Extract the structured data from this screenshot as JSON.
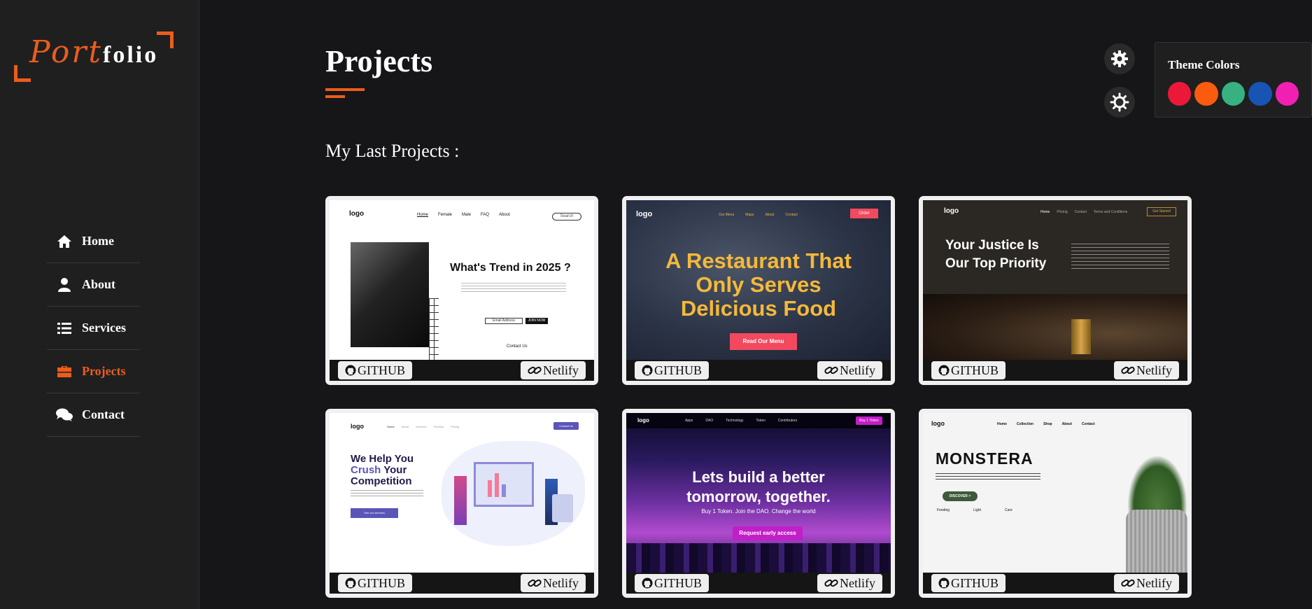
{
  "logo": {
    "part1": "Port",
    "part2": "folio"
  },
  "nav": [
    {
      "label": "Home",
      "icon": "home-icon"
    },
    {
      "label": "About",
      "icon": "user-icon"
    },
    {
      "label": "Services",
      "icon": "list-icon"
    },
    {
      "label": "Projects",
      "icon": "briefcase-icon",
      "active": true
    },
    {
      "label": "Contact",
      "icon": "comments-icon"
    }
  ],
  "page": {
    "title": "Projects",
    "subtitle": "My Last Projects :"
  },
  "theme": {
    "title": "Theme Colors",
    "colors": [
      "#ec1839",
      "#fa5b0f",
      "#37b182",
      "#1854b4",
      "#f021b2"
    ],
    "accent": "#ec5d1c"
  },
  "buttons": {
    "github": "GITHUB",
    "netlify": "Netlify"
  },
  "projects": [
    {
      "logo": "logo",
      "nav": [
        "Home",
        "Female",
        "Male",
        "FAQ",
        "About"
      ],
      "search": "Search",
      "headline": "What's Trend in 2025 ?",
      "email": "Email Address",
      "cta": "JOIN NOW",
      "contact": "Contact Us"
    },
    {
      "logo": "logo",
      "nav": [
        "Our Menu",
        "Maps",
        "About",
        "Contact"
      ],
      "order": "Order",
      "headline1": "A Restaurant That",
      "headline2": "Only Serves",
      "headline3": "Delicious Food",
      "cta": "Read Our Menu"
    },
    {
      "logo": "logo",
      "nav": [
        "Home",
        "Pricing",
        "Contact",
        "Terms and Conditions"
      ],
      "cta": "Get Started",
      "headline1": "Your Justice Is",
      "headline2": "Our Top Priority"
    },
    {
      "logo": "logo",
      "nav": [
        "Home",
        "About",
        "Services",
        "Portfolio",
        "Pricing"
      ],
      "contact": "Contact Us",
      "headline1": "We Help You",
      "headline2a": "Crush",
      "headline2b": "Your",
      "headline3": "Competition",
      "cta": "See our services"
    },
    {
      "logo": "logo",
      "nav": [
        "Apps",
        "DAO",
        "Technology",
        "Token",
        "Contributors"
      ],
      "buy": "Buy 1 Token",
      "headline1": "Lets build a better",
      "headline2": "tomorrow, together.",
      "sub": "Buy 1 Token. Join the DAO. Change the world",
      "cta": "Request early access"
    },
    {
      "logo": "logo",
      "nav": [
        "Home",
        "Collection",
        "Shop",
        "About",
        "Contact"
      ],
      "headline": "MONSTERA",
      "cta": "DISCOVER >",
      "features": [
        "Feeding",
        "Light",
        "Care"
      ]
    }
  ]
}
